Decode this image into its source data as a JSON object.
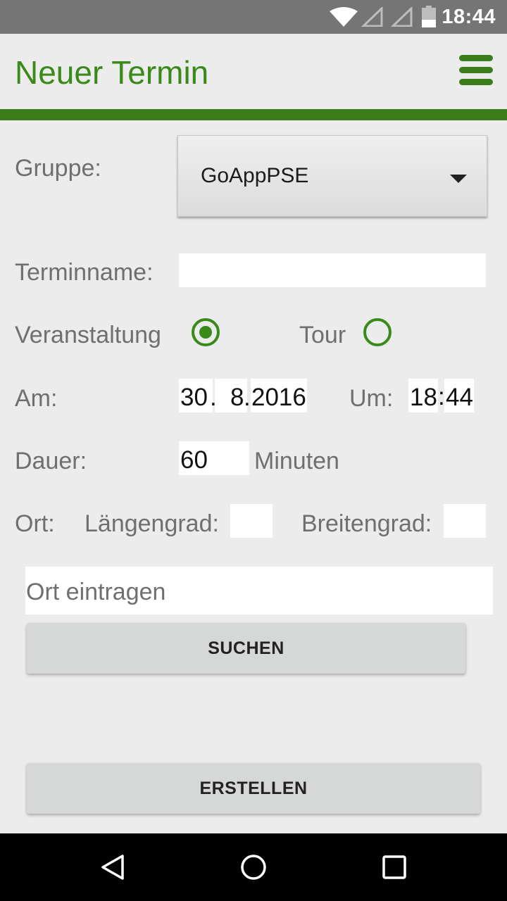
{
  "status_bar": {
    "time": "18:44"
  },
  "app_bar": {
    "title": "Neuer Termin",
    "menu_icon": "hamburger-menu-icon"
  },
  "colors": {
    "accent": "#3a7d1a",
    "background": "#ececec",
    "status_bar": "#757575"
  },
  "form": {
    "group_label": "Gruppe:",
    "group_value": "GoAppPSE",
    "name_label": "Terminname:",
    "name_value": "",
    "type_options": [
      {
        "label": "Veranstaltung",
        "selected": true
      },
      {
        "label": "Tour",
        "selected": false
      }
    ],
    "date_label": "Am:",
    "date_day": "30",
    "date_month": "8",
    "date_year": "2016",
    "date_sep": ".",
    "time_label": "Um:",
    "time_hour": "18",
    "time_minute": "44",
    "time_sep": ":",
    "duration_label": "Dauer:",
    "duration_value": "60",
    "duration_unit": "Minuten",
    "location_label": "Ort:",
    "longitude_label": "Längengrad:",
    "longitude_value": "",
    "latitude_label": "Breitengrad:",
    "latitude_value": "",
    "location_search_placeholder": "Ort eintragen",
    "search_button": "SUCHEN",
    "create_button": "ERSTELLEN"
  },
  "nav_bar": {
    "back_icon": "back-triangle-icon",
    "home_icon": "home-circle-icon",
    "recents_icon": "recents-square-icon"
  }
}
